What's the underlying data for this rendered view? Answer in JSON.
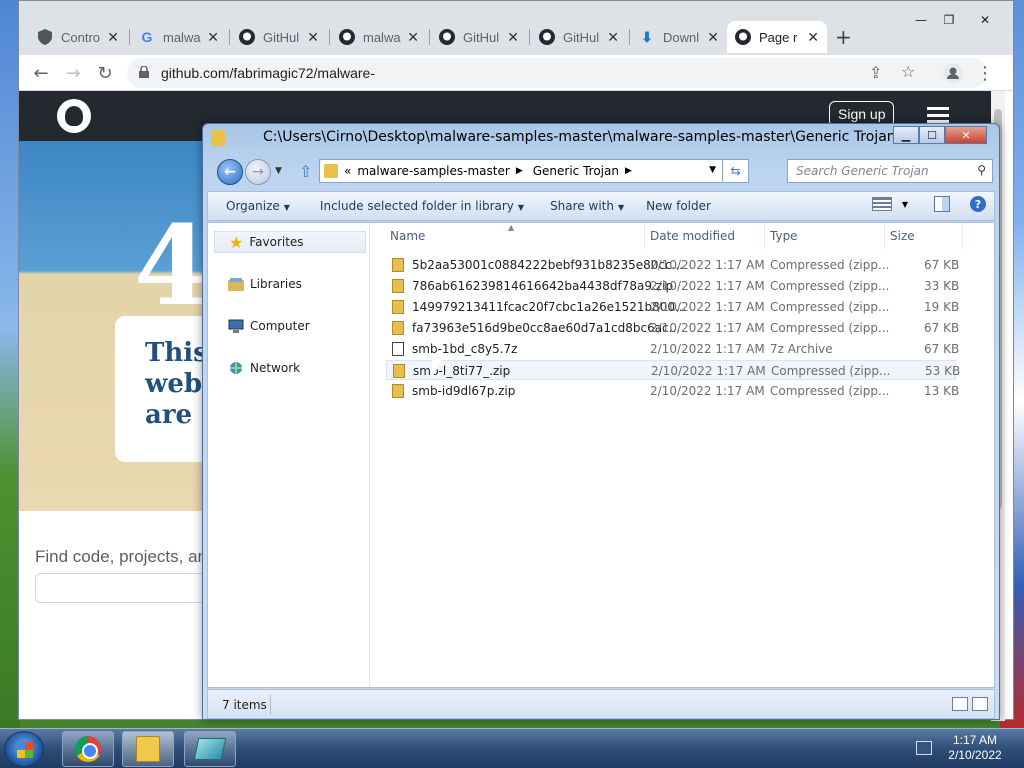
{
  "browser": {
    "tabs": [
      {
        "label": "Contro",
        "icon": "shield-icon"
      },
      {
        "label": "malwa",
        "icon": "google-icon"
      },
      {
        "label": "GitHul",
        "icon": "github-icon"
      },
      {
        "label": "malwa",
        "icon": "github-icon"
      },
      {
        "label": "GitHul",
        "icon": "github-icon"
      },
      {
        "label": "GitHul",
        "icon": "github-icon"
      },
      {
        "label": "Downl",
        "icon": "download-icon"
      },
      {
        "label": "Page r",
        "icon": "github-icon",
        "active": true
      }
    ],
    "url": "github.com/fabrimagic72/malware-"
  },
  "github": {
    "signup_label": "Sign up",
    "hero_big": "4",
    "card_lines": [
      "This",
      "web",
      "are l"
    ],
    "find_text": "Find code, projects, an"
  },
  "explorer": {
    "title": "C:\\Users\\Cirno\\Desktop\\malware-samples-master\\malware-samples-master\\Generic Trojan",
    "breadcrumb": [
      "malware-samples-master",
      "Generic Trojan"
    ],
    "breadcrumb_prefix": "«",
    "search_placeholder": "Search Generic Trojan",
    "commands": {
      "organize": "Organize",
      "include": "Include selected folder in library",
      "share": "Share with",
      "new_folder": "New folder"
    },
    "nav": {
      "favorites": "Favorites",
      "libraries": "Libraries",
      "computer": "Computer",
      "network": "Network"
    },
    "columns": {
      "name": "Name",
      "date": "Date modified",
      "type": "Type",
      "size": "Size"
    },
    "files": [
      {
        "name": "5b2aa53001c0884222bebf931b8235e80cc...",
        "date": "2/10/2022 1:17 AM",
        "type": "Compressed (zipp...",
        "size": "67 KB",
        "kind": "zip"
      },
      {
        "name": "786ab616239814616642ba4438df78a9.zip",
        "date": "2/10/2022 1:17 AM",
        "type": "Compressed (zipp...",
        "size": "33 KB",
        "kind": "zip"
      },
      {
        "name": "149979213411fcac20f7cbc1a26e1521b800...",
        "date": "2/10/2022 1:17 AM",
        "type": "Compressed (zipp...",
        "size": "19 KB",
        "kind": "zip"
      },
      {
        "name": "fa73963e516d9be0cc8ae60d7a1cd8bc6ac...",
        "date": "2/10/2022 1:17 AM",
        "type": "Compressed (zipp...",
        "size": "67 KB",
        "kind": "zip"
      },
      {
        "name": "smb-1bd_c8y5.7z",
        "date": "2/10/2022 1:17 AM",
        "type": "7z Archive",
        "size": "67 KB",
        "kind": "7z"
      },
      {
        "name": "smb-l_8ti77_.zip",
        "date": "2/10/2022 1:17 AM",
        "type": "Compressed (zipp...",
        "size": "53 KB",
        "kind": "zip",
        "hover": true
      },
      {
        "name": "smb-id9dl67p.zip",
        "date": "2/10/2022 1:17 AM",
        "type": "Compressed (zipp...",
        "size": "13 KB",
        "kind": "zip"
      }
    ],
    "status": "7 items"
  },
  "taskbar": {
    "time": "1:17 AM",
    "date": "2/10/2022"
  }
}
